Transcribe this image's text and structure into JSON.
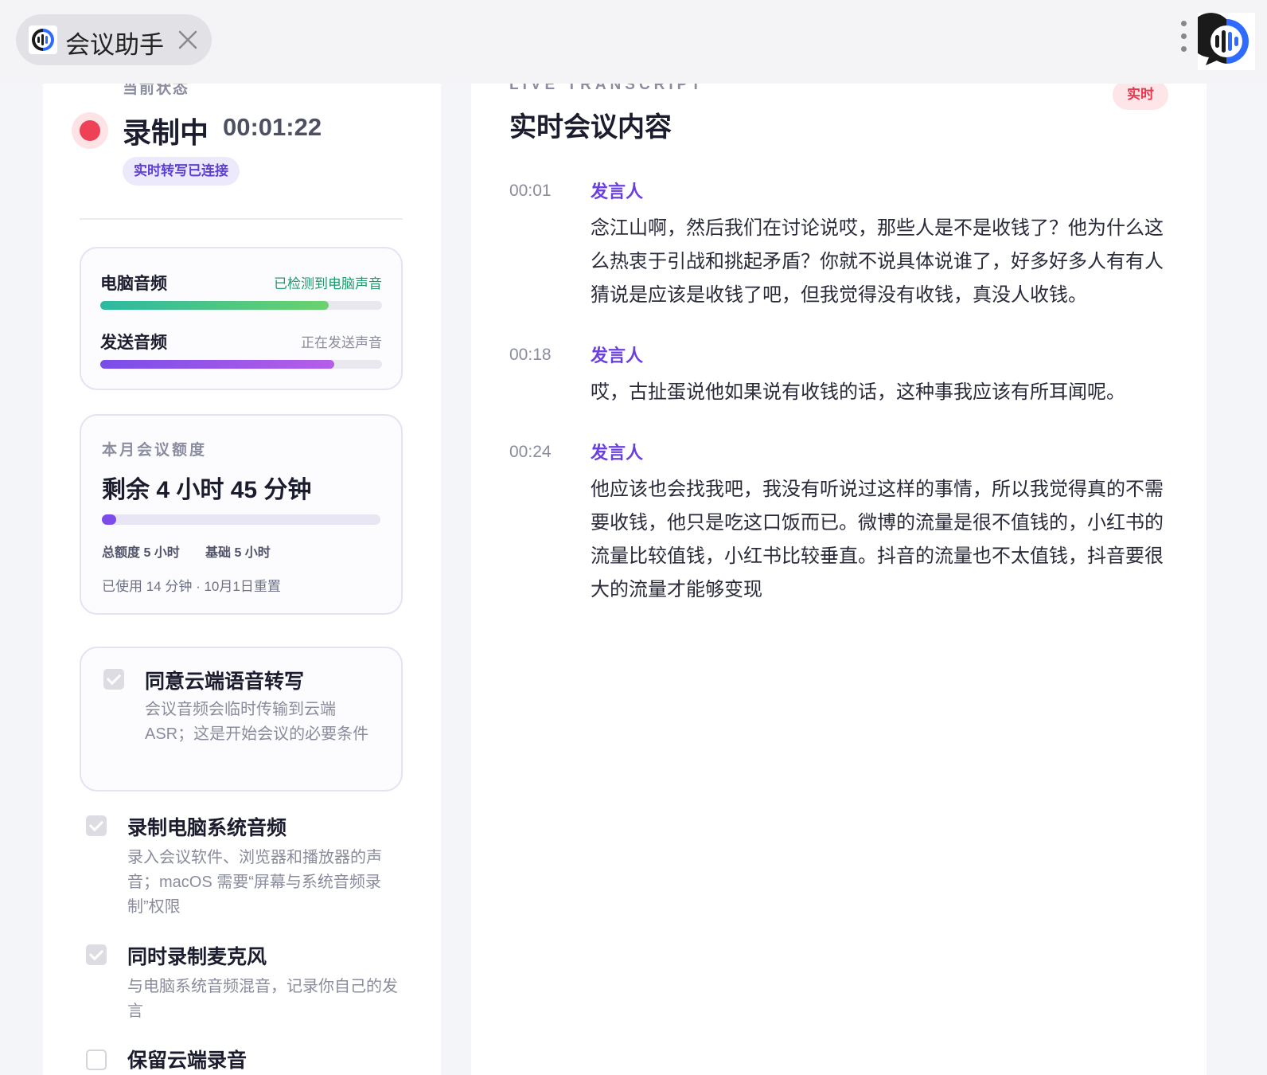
{
  "app": {
    "tab_title": "会议助手"
  },
  "status": {
    "label": "当前状态",
    "title": "录制中",
    "timer": "00:01:22",
    "badge": "实时转写已连接"
  },
  "audio": {
    "computer": {
      "label": "电脑音频",
      "status": "已检测到电脑声音",
      "level": 0.81
    },
    "send": {
      "label": "发送音频",
      "status": "正在发送声音",
      "level": 0.83
    }
  },
  "quota": {
    "label": "本月会议额度",
    "remaining": "剩余 4 小时 45 分钟",
    "used_fraction": 0.05,
    "total": "总额度 5 小时",
    "base": "基础 5 小时",
    "note": "已使用 14 分钟 · 10月1日重置"
  },
  "options": [
    {
      "title": "同意云端语音转写",
      "desc": "会议音频会临时传输到云端ASR；这是开始会议的必要条件",
      "checked": true
    },
    {
      "title": "录制电脑系统音频",
      "desc": "录入会议软件、浏览器和播放器的声音；macOS 需要“屏幕与系统音频录制”权限",
      "checked": true
    },
    {
      "title": "同时录制麦克风",
      "desc": "与电脑系统音频混音，记录你自己的发言",
      "checked": true
    },
    {
      "title": "保留云端录音",
      "desc": "",
      "checked": false
    }
  ],
  "transcript": {
    "label": "LIVE TRANSCRIPT",
    "title": "实时会议内容",
    "badge": "实时",
    "entries": [
      {
        "time": "00:01",
        "speaker": "发言人",
        "text": "念江山啊，然后我们在讨论说哎，那些人是不是收钱了？他为什么这么热衷于引战和挑起矛盾？你就不说具体说谁了，好多好多人有有人猜说是应该是收钱了吧，但我觉得没有收钱，真没人收钱。"
      },
      {
        "time": "00:18",
        "speaker": "发言人",
        "text": "哎，古扯蛋说他如果说有收钱的话，这种事我应该有所耳闻呢。"
      },
      {
        "time": "00:24",
        "speaker": "发言人",
        "text": "他应该也会找我吧，我没有听说过这样的事情，所以我觉得真的不需要收钱，他只是吃这口饭而已。微博的流量是很不值钱的，小红书的流量比较值钱，小红书比较垂直。抖音的流量也不太值钱，抖音要很大的流量才能够变现"
      }
    ]
  },
  "colors": {
    "accent": "#6a3fe0",
    "record": "#ef4156",
    "detected": "#1f9a6b"
  }
}
